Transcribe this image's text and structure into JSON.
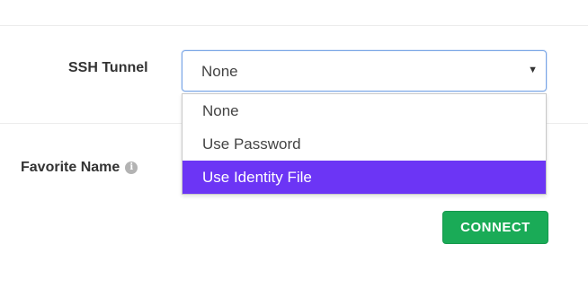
{
  "ssh_tunnel": {
    "label": "SSH Tunnel",
    "selected_value": "None",
    "options": [
      "None",
      "Use Password",
      "Use Identity File"
    ],
    "highlighted_index": 2,
    "highlight_color": "#6c35f5",
    "focus_border_color": "#7aa6e6"
  },
  "favorite_name": {
    "label": "Favorite Name",
    "info_icon": "info-icon"
  },
  "connect_button": {
    "label": "CONNECT",
    "color": "#1aab57"
  }
}
